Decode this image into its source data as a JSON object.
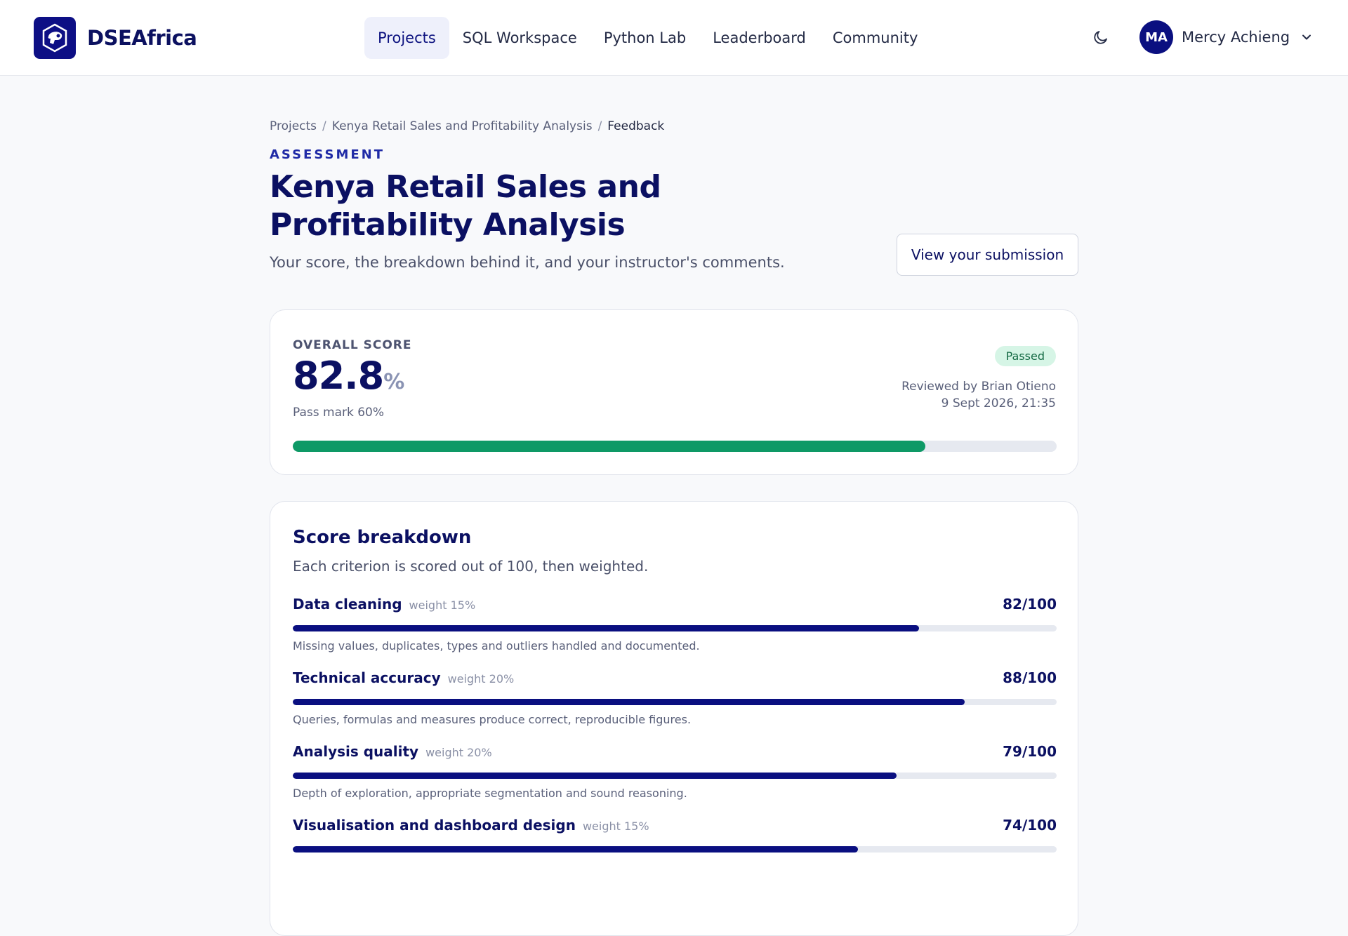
{
  "brand": {
    "name": "DSEAfrica",
    "logo_icon": "brand-logo-icon"
  },
  "nav": {
    "items": [
      {
        "label": "Projects",
        "active": true
      },
      {
        "label": "SQL Workspace",
        "active": false
      },
      {
        "label": "Python Lab",
        "active": false
      },
      {
        "label": "Leaderboard",
        "active": false
      },
      {
        "label": "Community",
        "active": false
      }
    ]
  },
  "user": {
    "initials": "MA",
    "name": "Mercy Achieng"
  },
  "breadcrumb": {
    "items": [
      "Projects",
      "Kenya Retail Sales and Profitability Analysis",
      "Feedback"
    ],
    "separator": "/"
  },
  "page": {
    "eyebrow": "ASSESSMENT",
    "title": "Kenya Retail Sales and Profitability Analysis",
    "subtitle": "Your score, the breakdown behind it, and your instructor's comments.",
    "view_button": "View your submission"
  },
  "score": {
    "label": "OVERALL SCORE",
    "value": "82.8",
    "unit": "%",
    "progress_fraction": 0.828,
    "pass_mark": "Pass mark 60%",
    "status": "Passed",
    "reviewed_by": "Reviewed by Brian Otieno",
    "reviewed_at": "9 Sept 2026, 21:35"
  },
  "breakdown": {
    "title": "Score breakdown",
    "subtitle": "Each criterion is scored out of 100, then weighted.",
    "criteria": [
      {
        "name": "Data cleaning",
        "weight": "weight 15%",
        "score": "82/100",
        "fraction": 0.82,
        "description": "Missing values, duplicates, types and outliers handled and documented."
      },
      {
        "name": "Technical accuracy",
        "weight": "weight 20%",
        "score": "88/100",
        "fraction": 0.88,
        "description": "Queries, formulas and measures produce correct, reproducible figures."
      },
      {
        "name": "Analysis quality",
        "weight": "weight 20%",
        "score": "79/100",
        "fraction": 0.79,
        "description": "Depth of exploration, appropriate segmentation and sound reasoning."
      },
      {
        "name": "Visualisation and dashboard design",
        "weight": "weight 15%",
        "score": "74/100",
        "fraction": 0.74,
        "description": ""
      }
    ]
  },
  "colors": {
    "accent": "#0a0f80",
    "success": "#0e9966",
    "badge_bg": "#d6f5e6"
  }
}
